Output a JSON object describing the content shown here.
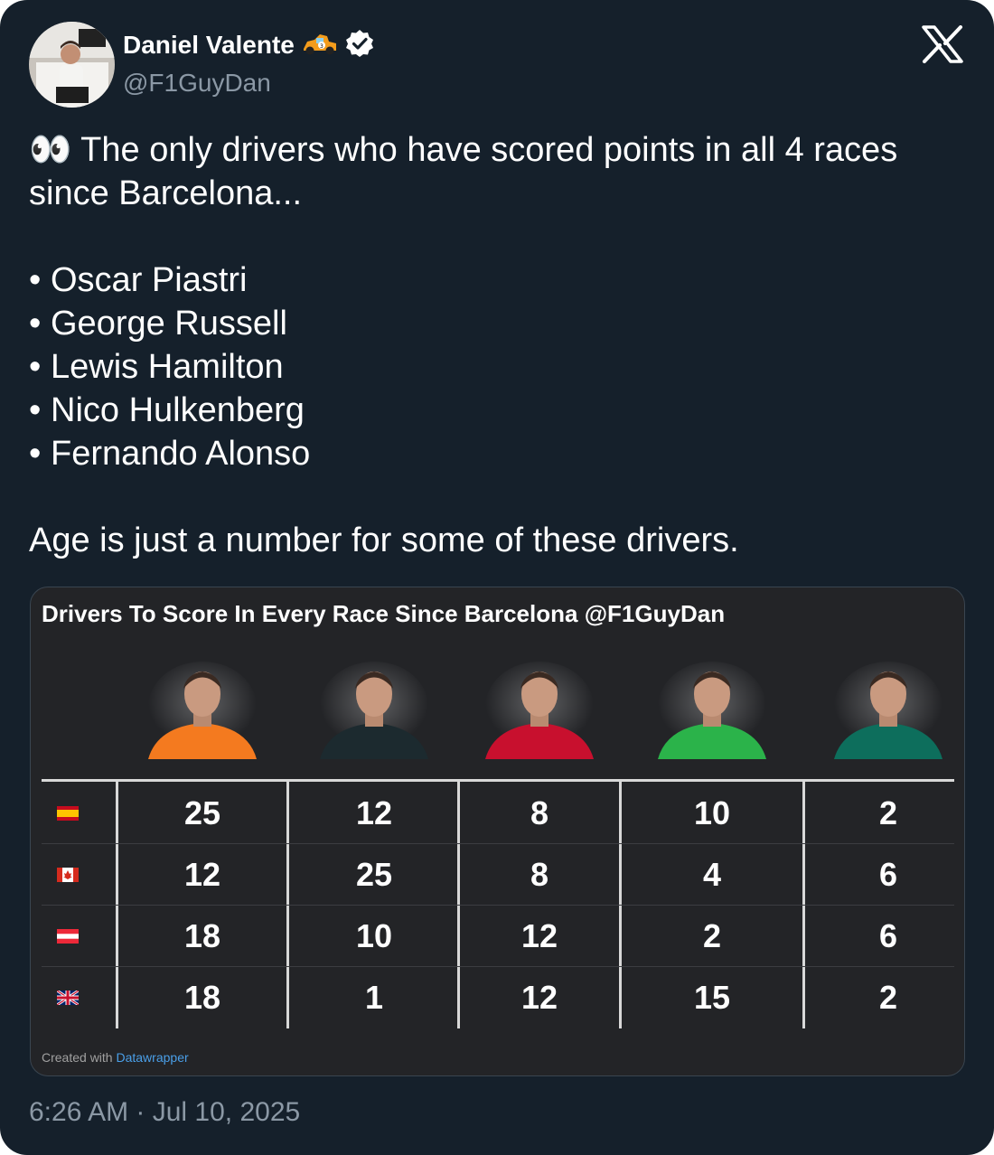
{
  "author": {
    "name": "Daniel Valente",
    "handle": "@F1GuyDan",
    "emoji": "race-car-emoji",
    "verified": true
  },
  "tweet": {
    "intro": "👀 The only drivers who have scored points in all 4 races since Barcelona...",
    "drivers": [
      "Oscar Piastri",
      "George Russell",
      "Lewis Hamilton",
      "Nico Hulkenberg",
      "Fernando Alonso"
    ],
    "outro": "Age is just a number for some of these drivers."
  },
  "media": {
    "title": "Drivers To Score In Every Race Since Barcelona @F1GuyDan",
    "credit_prefix": "Created with",
    "credit_link": "Datawrapper",
    "table": {
      "rows": [
        {
          "flag": "spain-flag-icon",
          "values": [
            "25",
            "12",
            "8",
            "10",
            "2"
          ]
        },
        {
          "flag": "canada-flag-icon",
          "values": [
            "12",
            "25",
            "8",
            "4",
            "6"
          ]
        },
        {
          "flag": "austria-flag-icon",
          "values": [
            "18",
            "10",
            "12",
            "2",
            "6"
          ]
        },
        {
          "flag": "uk-flag-icon",
          "values": [
            "18",
            "1",
            "12",
            "15",
            "2"
          ]
        }
      ],
      "driver_colors": [
        "#f47a1f",
        "#1c2a2f",
        "#c8102e",
        "#2bb34a",
        "#0d6e5c"
      ]
    }
  },
  "timestamp": "6:26 AM · Jul 10, 2025",
  "colors": {
    "background": "#15202b",
    "text": "#e7e9ea",
    "secondary": "#8b98a5",
    "link": "#4a9fe8"
  }
}
